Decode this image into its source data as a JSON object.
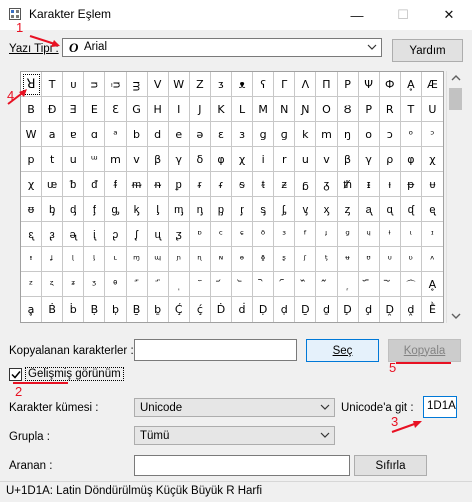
{
  "window": {
    "title": "Karakter Eşlem",
    "minimize_glyph": "—",
    "maximize_glyph": "☐",
    "close_glyph": "✕"
  },
  "font_row": {
    "label": "Yazı Tipi :",
    "font_icon": "O",
    "font_name": "Arial",
    "help_button": "Yardım"
  },
  "grid": {
    "selected_index": 0,
    "chars": [
      "ꓤ",
      "T",
      "ᴜ",
      "ᴝ",
      "ᴞ",
      "ᴟ",
      "V",
      "W",
      "Z",
      "ᴣ",
      "ᴥ",
      "ʕ",
      "Γ",
      "Λ",
      "Π",
      "Ρ",
      "Ψ",
      "Ф",
      "Ḁ",
      "Æ",
      "B",
      "Ð",
      "Ǝ",
      "E",
      "Ɛ",
      "G",
      "H",
      "I",
      "J",
      "K",
      "L",
      "M",
      "N",
      "Ɲ",
      "O",
      "Ȣ",
      "P",
      "R",
      "T",
      "U",
      "W",
      "a",
      "ɐ",
      "ɑ",
      "ᵃ",
      "b",
      "d",
      "e",
      "ə",
      "ɛ",
      "ɜ",
      "g",
      "ɡ",
      "k",
      "m",
      "ŋ",
      "o",
      "ɔ",
      "ᵒ",
      "ᵓ",
      "p",
      "t",
      "u",
      "ᵚ",
      "m",
      "v",
      "β",
      "γ",
      "δ",
      "φ",
      "χ",
      "i",
      "r",
      "u",
      "v",
      "β",
      "γ",
      "ρ",
      "φ",
      "χ",
      "χ",
      "ᵫ",
      "ᵬ",
      "ᵭ",
      "ᵮ",
      "ᵯ",
      "ᵰ",
      "ᵱ",
      "ᵲ",
      "ᵳ",
      "ᵴ",
      "ᵵ",
      "ᵶ",
      "ᵷ",
      "ᵹ",
      "ᵺ",
      "ᵻ",
      "ᵼ",
      "ᵽ",
      "ᵾ",
      "ᵿ",
      "ᶀ",
      "ᶁ",
      "ᶂ",
      "ᶃ",
      "ᶄ",
      "ᶅ",
      "ᶆ",
      "ᶇ",
      "ᶈ",
      "ᶉ",
      "ᶊ",
      "ᶋ",
      "ᶌ",
      "ᶍ",
      "ᶎ",
      "ᶏ",
      "ᶐ",
      "ᶑ",
      "ᶒ",
      "ᶓ",
      "ᶔ",
      "ᶕ",
      "ᶖ",
      "ᶗ",
      "ᶘ",
      "ᶙ",
      "ᶚ",
      "ᶛ",
      "ᶜ",
      "ᶝ",
      "ᶞ",
      "ᶟ",
      "ᶠ",
      "ᶡ",
      "ᶢ",
      "ᶣ",
      "ᶤ",
      "ᶥ",
      "ᶦ",
      "ᶧ",
      "ᶨ",
      "ᶩ",
      "ᶪ",
      "ᶫ",
      "ᶬ",
      "ᶭ",
      "ᶮ",
      "ᶯ",
      "ᶰ",
      "ᶱ",
      "ᶲ",
      "ᶳ",
      "ᶴ",
      "ᶵ",
      "ᶶ",
      "ᶷ",
      "ᶸ",
      "ᶹ",
      "ᶺ",
      "ᶻ",
      "ᶼ",
      "ᶽ",
      "ᶾ",
      "ᶿ",
      "᷀",
      "᷁",
      "᷂",
      "᷃",
      "᷄",
      "᷅",
      "᷆",
      "᷇",
      "᷈",
      "᷉",
      "᷊",
      "᷋",
      "᷌",
      "᷍",
      "Ḁ",
      "ḁ",
      "Ḃ",
      "ḃ",
      "Ḅ",
      "ḅ",
      "Ḇ",
      "ḇ",
      "Ḉ",
      "ḉ",
      "Ḋ",
      "ḋ",
      "Ḍ",
      "ḍ",
      "Ḏ",
      "ḏ",
      "Ḑ",
      "ḑ",
      "Ḓ",
      "ḓ",
      "Ḕ"
    ]
  },
  "copy_row": {
    "label": "Kopyalanan karakterler :",
    "value": "",
    "select_button": "Seç",
    "copy_button": "Kopyala"
  },
  "advanced": {
    "label": "Gelişmiş görünüm",
    "checked": true
  },
  "charset": {
    "label": "Karakter kümesi :",
    "value": "Unicode"
  },
  "goto_unicode": {
    "label": "Unicode'a git :",
    "value": "1D1A"
  },
  "group": {
    "label": "Grupla :",
    "value": "Tümü"
  },
  "search": {
    "label": "Aranan :",
    "value": "",
    "button": "Sıfırla"
  },
  "status": {
    "text": "U+1D1A: Latin Döndürülmüş Küçük Büyük R Harfi"
  },
  "annotations": {
    "labels": [
      "1",
      "2",
      "3",
      "4",
      "5"
    ],
    "color": "#e81123"
  }
}
